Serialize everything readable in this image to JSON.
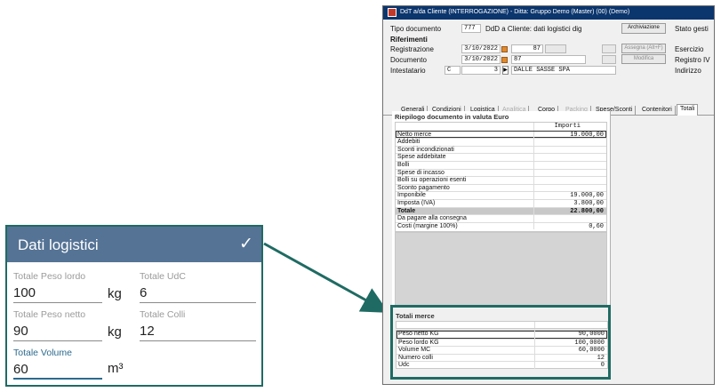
{
  "mobile": {
    "title": "Dati logistici",
    "check_glyph": "✓",
    "fields": [
      {
        "label": "Totale Peso lordo",
        "value": "100",
        "unit": "kg"
      },
      {
        "label": "Totale UdC",
        "value": "6",
        "unit": ""
      },
      {
        "label": "Totale Peso netto",
        "value": "90",
        "unit": "kg"
      },
      {
        "label": "Totale Colli",
        "value": "12",
        "unit": ""
      },
      {
        "label": "Totale Volume",
        "value": "60",
        "unit": "m³"
      }
    ]
  },
  "window": {
    "title": "DdT a/da Cliente (INTERROGAZIONE) - Ditta: Gruppo Demo (Master) (00) (Demo)",
    "tipo_label": "Tipo documento",
    "tipo_code": "777",
    "tipo_desc": "DdD a Cliente: dati logistici dig",
    "archiviazione": "Archiviazione",
    "stato_label": "Stato gesti",
    "riferimenti": "Riferimenti",
    "registrazione_label": "Registrazione",
    "registrazione_date": "3/10/2022",
    "registrazione_num": "87",
    "assegna": "Assegna (Alt+F)",
    "esercizio": "Esercizio",
    "documento_label": "Documento",
    "documento_date": "3/10/2022",
    "documento_num": "87",
    "modifica": "Modifica",
    "registro": "Registro IV",
    "intestatario_label": "Intestatario",
    "intestatario_type": "C",
    "intestatario_code": "3",
    "intestatario_name": "DALLE SASSE SPA",
    "indirizzo": "Indirizzo",
    "tabs": [
      "Generali",
      "Condizioni",
      "Logistica",
      "Analitica",
      "Corpo",
      "Packing",
      "Spese/Sconti",
      "Contenitori",
      "Totali"
    ],
    "riepilogo_title": "Riepilogo documento in valuta Euro",
    "importi_header": "Importi",
    "riepilogo_rows": [
      {
        "label": "Netto merce",
        "value": "19.000,00"
      },
      {
        "label": "Addebiti",
        "value": ""
      },
      {
        "label": "Sconti incondizionati",
        "value": ""
      },
      {
        "label": "Spese addebitate",
        "value": ""
      },
      {
        "label": "Bolli",
        "value": ""
      },
      {
        "label": "Spese di incasso",
        "value": ""
      },
      {
        "label": "Bolli su operazioni esenti",
        "value": ""
      },
      {
        "label": "Sconto pagamento",
        "value": ""
      },
      {
        "label": "Imponibile",
        "value": "19.000,00"
      },
      {
        "label": "Imposta (IVA)",
        "value": "3.800,00"
      },
      {
        "label": "Totale",
        "value": "22.800,00"
      },
      {
        "label": "Da pagare alla consegna",
        "value": ""
      },
      {
        "label": "Costi (margine 100%)",
        "value": "0,60"
      }
    ],
    "totali_merce_title": "Totali merce",
    "totali_rows": [
      {
        "label": "Peso netto KG",
        "value": "90,0000"
      },
      {
        "label": "Peso lordo KG",
        "value": "100,0000"
      },
      {
        "label": "Volume MC",
        "value": "60,0000"
      },
      {
        "label": "Numero colli",
        "value": "12"
      },
      {
        "label": "Udc",
        "value": "0"
      }
    ]
  }
}
